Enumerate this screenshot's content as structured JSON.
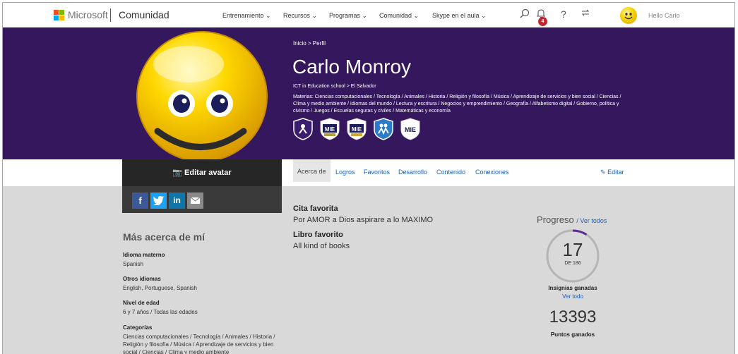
{
  "nav": {
    "brand_word": "Microsoft",
    "brand_section": "Comunidad",
    "menus": [
      "Entrenamiento ⌄",
      "Recursos ⌄",
      "Programas ⌄",
      "Comunidad ⌄",
      "Skype en el aula ⌄"
    ],
    "notification_count": "4",
    "greeting": "Hello Carlo"
  },
  "profile": {
    "breadcrumb": "Inicio  >  Perfil",
    "name": "Carlo Monroy",
    "school": "ICT in Education school  >  El Salvador",
    "subjects": "Materias: Ciencias computacionales / Tecnología / Animales / Historia / Religión y filosofía / Música / Aprendizaje de servicios y bien social / Ciencias / Clima y medio ambiente / Idiomas del mundo / Lectura y escritura / Negocios y emprendimiento / Geografía / Alfabetismo digital / Gobierno, política y civismo / Juegos / Escuelas seguras y civiles / Matemáticas y economía",
    "badge_labels": [
      "MIE",
      "MIE",
      "MIE"
    ],
    "edit_avatar": "Editar avatar"
  },
  "tabs": {
    "items": [
      "Acerca de",
      "Logros",
      "Favoritos",
      "Desarrollo",
      "Contenido",
      "Conexiones"
    ],
    "active": "Acerca de",
    "edit": "Editar"
  },
  "social": [
    "f",
    "in"
  ],
  "about": {
    "title": "Más acerca de mí",
    "fields": [
      {
        "label": "Idioma materno",
        "value": "Spanish"
      },
      {
        "label": "Otros idiomas",
        "value": "English, Portuguese, Spanish"
      },
      {
        "label": "Nivel de edad",
        "value": "6 y 7 años / Todas las edades"
      },
      {
        "label": "Categorías",
        "value": "Ciencias computacionales / Tecnología / Animales / Historia / Religión y filosofía / Música / Aprendizaje de servicios y bien social / Ciencias / Clima y medio ambiente"
      }
    ]
  },
  "favorites": {
    "quote_label": "Cita favorita",
    "quote_value": "Por AMOR a Dios aspirare a lo MAXIMO",
    "book_label": "Libro favorito",
    "book_value": "All kind of books"
  },
  "progress": {
    "title": "Progreso",
    "see_all": "/ Ver todos",
    "badges_count": "17",
    "badges_total": "DE 186",
    "badges_fraction": 0.091,
    "badges_label": "Insignias ganadas",
    "badges_link": "Ver todo",
    "points": "13393",
    "points_label": "Puntos ganados"
  },
  "colors": {
    "header_purple": "#35175e",
    "link_blue": "#1b5fb5",
    "ring_accent": "#5b2d90"
  },
  "icons": [
    "search-icon",
    "bell-icon",
    "help-icon",
    "switch-icon",
    "camera-icon",
    "pencil-icon",
    "facebook-icon",
    "twitter-icon",
    "linkedin-icon",
    "mail-icon"
  ]
}
